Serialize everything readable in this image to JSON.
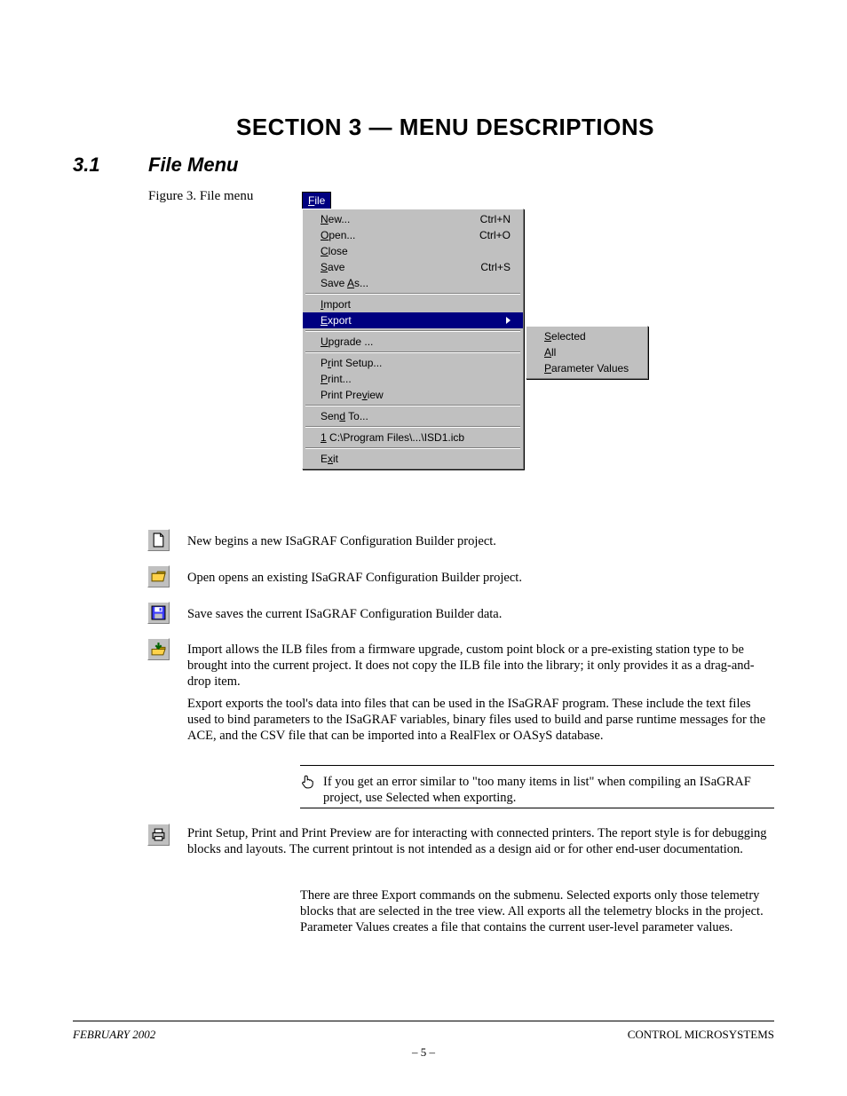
{
  "heading": "SECTION 3 — MENU DESCRIPTIONS",
  "section": {
    "number": "3.1",
    "title": "File Menu"
  },
  "figure_caption": "Figure 3. File menu",
  "menu": {
    "title_letter": "F",
    "title_rest": "ile",
    "items": [
      {
        "label_u": "N",
        "label_rest": "ew...",
        "accel": "Ctrl+N"
      },
      {
        "label_u": "O",
        "label_rest": "pen...",
        "accel": "Ctrl+O"
      },
      {
        "label_u": "C",
        "label_rest": "lose",
        "accel": ""
      },
      {
        "label_u": "S",
        "label_rest": "ave",
        "accel": "Ctrl+S"
      },
      {
        "label_pre": "Save ",
        "label_u": "A",
        "label_rest": "s...",
        "accel": ""
      },
      {
        "separator": true
      },
      {
        "label_u": "I",
        "label_rest": "mport",
        "accel": ""
      },
      {
        "label_u": "E",
        "label_rest": "xport",
        "accel": "",
        "highlight": true,
        "submenu": true
      },
      {
        "separator": true
      },
      {
        "label_u": "U",
        "label_rest": "pgrade ...",
        "accel": ""
      },
      {
        "separator": true
      },
      {
        "label_pre": "P",
        "label_u": "r",
        "label_rest": "int Setup...",
        "accel": ""
      },
      {
        "label_u": "P",
        "label_rest": "rint...",
        "accel": ""
      },
      {
        "label_pre": "Print Pre",
        "label_u": "v",
        "label_rest": "iew",
        "accel": ""
      },
      {
        "separator": true
      },
      {
        "label_pre": "Sen",
        "label_u": "d",
        "label_rest": " To...",
        "accel": ""
      },
      {
        "separator": true
      },
      {
        "label_u": "1",
        "label_rest": " C:\\Program Files\\...\\ISD1.icb",
        "accel": ""
      },
      {
        "separator": true
      },
      {
        "label_pre": "E",
        "label_u": "x",
        "label_rest": "it",
        "accel": ""
      }
    ],
    "submenu": [
      {
        "label_u": "S",
        "label_rest": "elected"
      },
      {
        "label_u": "A",
        "label_rest": "ll"
      },
      {
        "label_u": "P",
        "label_rest": "arameter Values"
      }
    ]
  },
  "desc": {
    "new": "New begins a new ISaGRAF Configuration Builder project.",
    "open": "Open opens an existing ISaGRAF Configuration Builder project.",
    "save": "Save saves the current ISaGRAF Configuration Builder data.",
    "import": "Import allows the ILB files from a firmware upgrade, custom point block or a pre-existing station type to be brought into the current project. It does not copy the ILB file into the library; it only provides it as a drag-and-drop item.",
    "export_header": "Export exports the tool's data into files that can be used in the ISaGRAF program. These include the text files used to bind parameters to the ISaGRAF variables, binary files used to build and parse runtime messages for the ACE, and the CSV file that can be imported into a RealFlex or OASyS database.",
    "export_sub": "There are three Export commands on the submenu. Selected exports only those telemetry blocks that are selected in the tree view. All exports all the telemetry blocks in the project. Parameter Values creates a file that contains the current user-level parameter values.",
    "tip": "If you get an error similar to \"too many items in list\" when compiling an ISaGRAF project, use Selected when exporting.",
    "print": "Print Setup, Print and Print Preview are for interacting with connected printers. The report style is for debugging blocks and layouts. The current printout is not intended as a design aid or for other end-user documentation."
  },
  "footer": {
    "date": "FEBRUARY 2002",
    "right": "CONTROL MICROSYSTEMS",
    "page": "– 5 –"
  }
}
